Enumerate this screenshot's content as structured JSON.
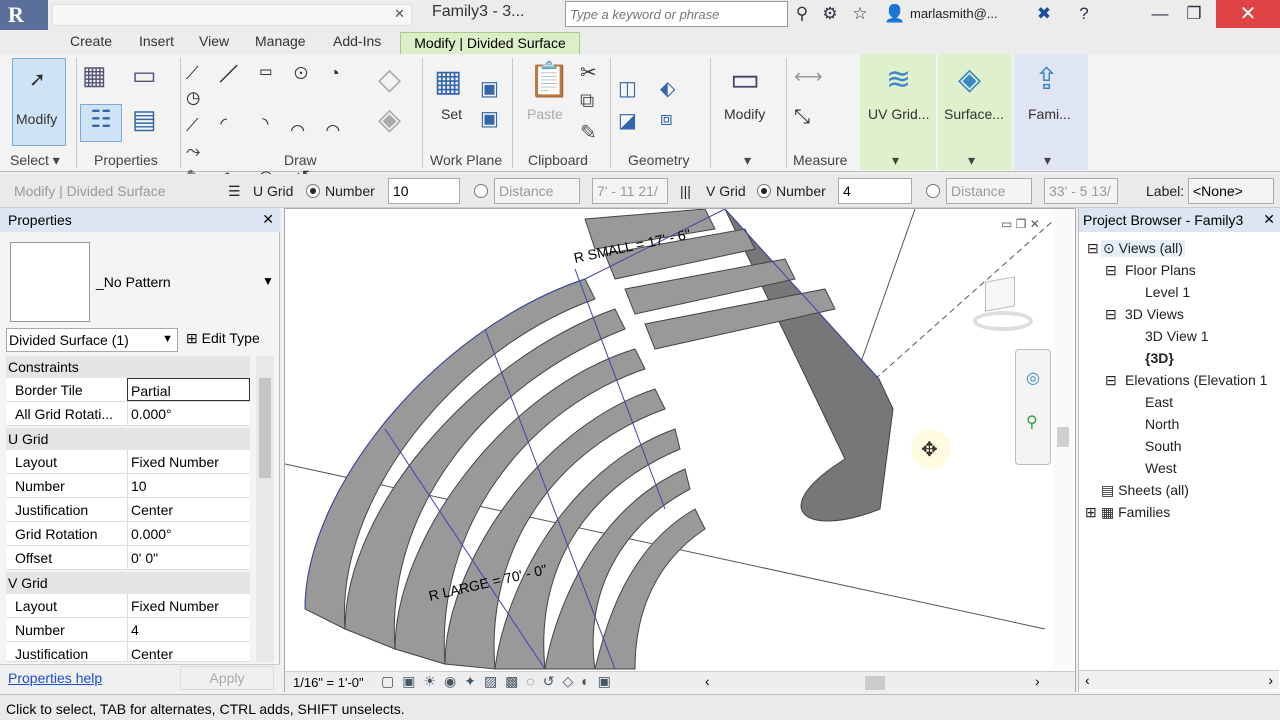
{
  "app": {
    "doc_title": "Family3 - 3...",
    "search_placeholder": "Type a keyword or phrase",
    "user": "marlasmith@...",
    "logo": "R"
  },
  "tabs": [
    "Create",
    "Insert",
    "View",
    "Manage",
    "Add-Ins",
    "Modify | Divided Surface"
  ],
  "ribbon": {
    "modify": "Modify",
    "set": "Set",
    "paste": "Paste",
    "modify2": "Modify",
    "uvgrid": "UV Grid...",
    "surface": "Surface...",
    "family": "Fami...",
    "panels": {
      "select": "Select ▾",
      "properties": "Properties",
      "draw": "Draw",
      "workplane": "Work Plane",
      "clipboard": "Clipboard",
      "geometry": "Geometry",
      "measure": "Measure"
    }
  },
  "options": {
    "context": "Modify | Divided Surface",
    "ugrid": "U Grid",
    "number": "Number",
    "u_value": "10",
    "distance": "Distance",
    "u_dist": "7' - 11 21/",
    "vgrid": "V Grid",
    "number2": "Number",
    "v_value": "4",
    "distance2": "Distance",
    "v_dist": "33' - 5 13/",
    "label": "Label:",
    "label_value": "<None>"
  },
  "properties": {
    "title": "Properties",
    "pattern": "_No Pattern",
    "type": "Divided Surface (1)",
    "edit_type": "Edit Type",
    "constraints": "Constraints",
    "rows1": [
      {
        "k": "Border Tile",
        "v": "Partial"
      },
      {
        "k": "All Grid Rotati...",
        "v": "0.000°"
      }
    ],
    "ugrid": "U Grid",
    "rows2": [
      {
        "k": "Layout",
        "v": "Fixed Number"
      },
      {
        "k": "Number",
        "v": "10"
      },
      {
        "k": "Justification",
        "v": "Center"
      },
      {
        "k": "Grid Rotation",
        "v": "0.000°"
      },
      {
        "k": "Offset",
        "v": "0'  0\""
      }
    ],
    "vgrid": "V Grid",
    "rows3": [
      {
        "k": "Layout",
        "v": "Fixed Number"
      },
      {
        "k": "Number",
        "v": "4"
      },
      {
        "k": "Justification",
        "v": "Center"
      }
    ],
    "help": "Properties help",
    "apply": "Apply"
  },
  "viewport": {
    "r_small": "R SMALL = 17' - 6\"",
    "r_large": "R LARGE = 70' - 0\"",
    "scale": "1/16\" = 1'-0\""
  },
  "browser": {
    "title": "Project Browser - Family3",
    "views": "Views (all)",
    "floor_plans": "Floor Plans",
    "level1": "Level 1",
    "views3d": "3D Views",
    "view3d1": "3D View 1",
    "view3d": "{3D}",
    "elevations": "Elevations (Elevation 1",
    "east": "East",
    "north": "North",
    "south": "South",
    "west": "West",
    "sheets": "Sheets (all)",
    "families": "Families"
  },
  "status": "Click to select, TAB for alternates, CTRL adds, SHIFT unselects."
}
